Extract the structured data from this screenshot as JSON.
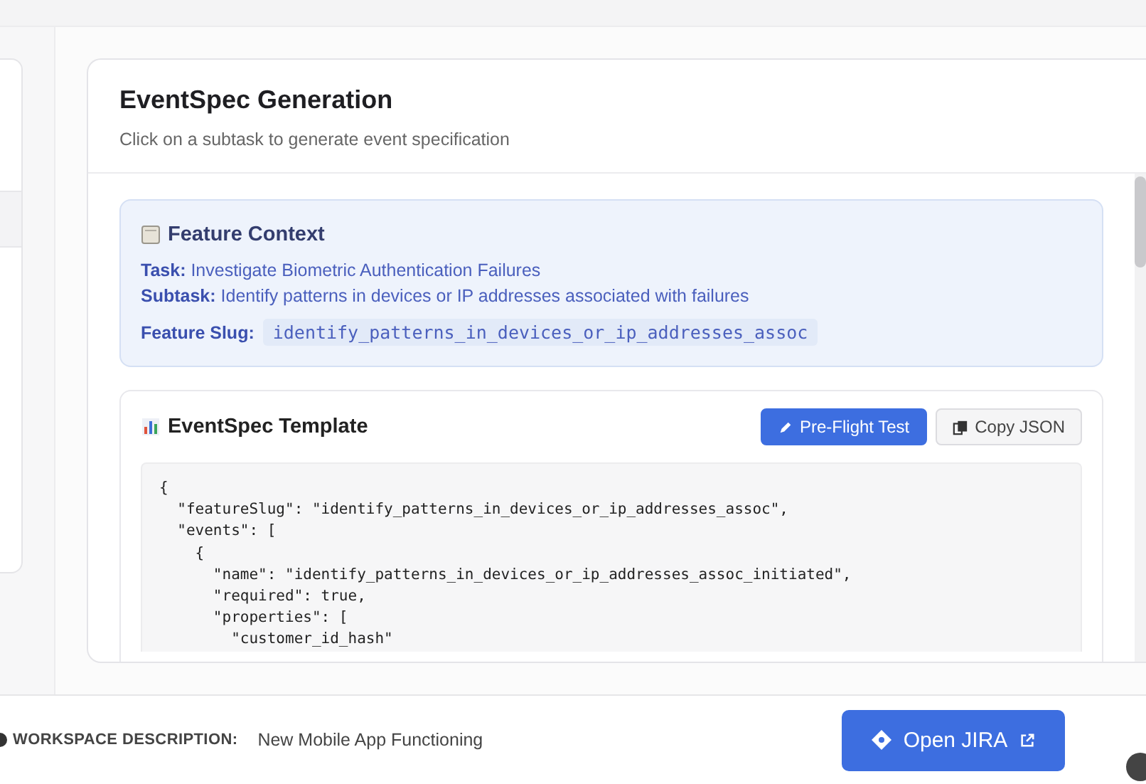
{
  "panel": {
    "title": "EventSpec Generation",
    "subtitle": "Click on a subtask to generate event specification"
  },
  "feature_context": {
    "title": "Feature Context",
    "task_label": "Task:",
    "task": "Investigate Biometric Authentication Failures",
    "subtask_label": "Subtask:",
    "subtask": "Identify patterns in devices or IP addresses associated with failures",
    "slug_label": "Feature Slug:",
    "slug": "identify_patterns_in_devices_or_ip_addresses_assoc"
  },
  "template": {
    "title": "EventSpec Template",
    "buttons": [
      {
        "label": "Pre-Flight Test",
        "kind": "primary"
      },
      {
        "label": "Copy JSON",
        "kind": "secondary"
      }
    ],
    "code_lines": [
      "{",
      "  \"featureSlug\": \"identify_patterns_in_devices_or_ip_addresses_assoc\",",
      "  \"events\": [",
      "    {",
      "      \"name\": \"identify_patterns_in_devices_or_ip_addresses_assoc_initiated\",",
      "      \"required\": true,",
      "      \"properties\": [",
      "        \"customer_id_hash\""
    ]
  },
  "footer": {
    "label": "WORKSPACE DESCRIPTION:",
    "value": "New Mobile App Functioning",
    "button": "Open JIRA"
  }
}
